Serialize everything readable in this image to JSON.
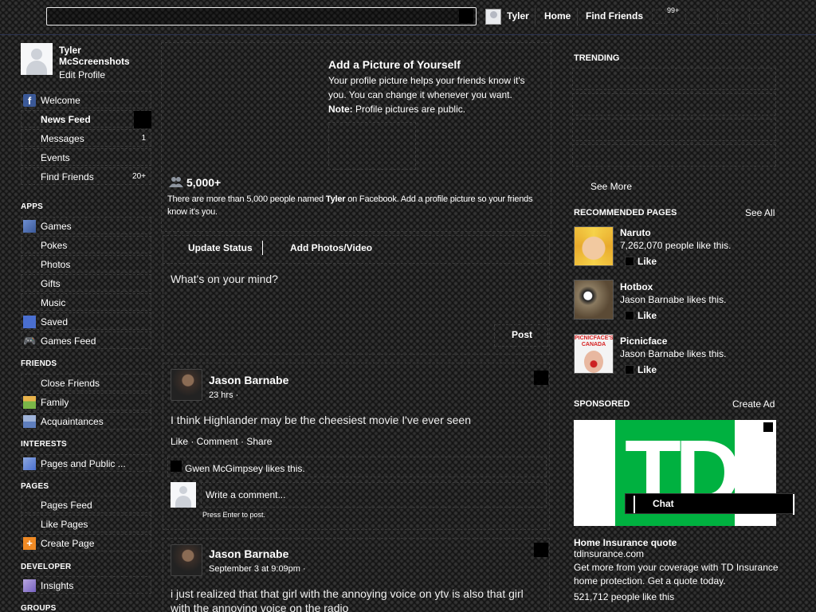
{
  "topbar": {
    "user": "Tyler",
    "home": "Home",
    "find_friends": "Find Friends",
    "badge": "99+"
  },
  "left": {
    "name": "Tyler McScreenshots",
    "edit_profile": "Edit Profile",
    "favorites": [
      {
        "label": "Welcome",
        "count": ""
      },
      {
        "label": "News Feed",
        "count": ""
      },
      {
        "label": "Messages",
        "count": "1"
      },
      {
        "label": "Events",
        "count": ""
      },
      {
        "label": "Find Friends",
        "count": "20+"
      }
    ],
    "apps_head": "APPS",
    "apps": [
      "Games",
      "Pokes",
      "Photos",
      "Gifts",
      "Music",
      "Saved",
      "Games Feed"
    ],
    "friends_head": "FRIENDS",
    "friends": [
      "Close Friends",
      "Family",
      "Acquaintances"
    ],
    "interests_head": "INTERESTS",
    "interests": [
      "Pages and Public ..."
    ],
    "pages_head": "PAGES",
    "pages": [
      "Pages Feed",
      "Like Pages",
      "Create Page"
    ],
    "developer_head": "DEVELOPER",
    "developer": [
      "Insights"
    ],
    "groups_head": "GROUPS"
  },
  "center": {
    "addpic": {
      "title": "Add a Picture of Yourself",
      "line1": "Your profile picture helps your friends know it's",
      "line2": "you. You can change it whenever you want.",
      "note_label": "Note:",
      "note_text": " Profile pictures are public."
    },
    "people": {
      "count": "5,000+",
      "text_a": "There are more than 5,000 people named ",
      "name": "Tyler",
      "text_b": " on Facebook. Add a profile picture so your friends know it's you."
    },
    "composer": {
      "tab_status": "Update Status",
      "tab_photos": "Add Photos/Video",
      "placeholder": "What's on your mind?",
      "post": "Post"
    },
    "stories": [
      {
        "author": "Jason Barnabe",
        "time": "23 hrs ·",
        "text": "I think Highlander may be the cheesiest movie I've ever seen",
        "actions": "Like · Comment · Share",
        "likes": "Gwen McGimpsey likes this.",
        "comment_placeholder": "Write a comment...",
        "press_enter": "Press Enter to post."
      },
      {
        "author": "Jason Barnabe",
        "time": "September 3 at 9:09pm ·",
        "text_line1": "i just realized that that girl with the annoying voice on ytv is also that girl",
        "text_line2": "with the annoying voice on the radio"
      }
    ]
  },
  "right": {
    "trending": "TRENDING",
    "see_more": "See More",
    "recommended": "RECOMMENDED PAGES",
    "see_all": "See All",
    "pages": [
      {
        "name": "Naruto",
        "sub": "7,262,070 people like this.",
        "like": "Like"
      },
      {
        "name": "Hotbox",
        "sub": "Jason Barnabe likes this.",
        "like": "Like"
      },
      {
        "name": "Picnicface",
        "sub": "Jason Barnabe likes this.",
        "like": "Like"
      }
    ],
    "picnicface_logo": "PICNICFACE'S CANADA",
    "sponsored": "SPONSORED",
    "create_ad": "Create Ad",
    "ad": {
      "logo": "TD",
      "title": "Home Insurance quote",
      "url": "tdinsurance.com",
      "desc": "Get more from your coverage with TD Insurance home protection. Get a quote today.",
      "likes": "521,712 people like this"
    },
    "chat": "Chat"
  },
  "colors": {
    "td_green": "#00b140",
    "text": "#ffffff"
  }
}
